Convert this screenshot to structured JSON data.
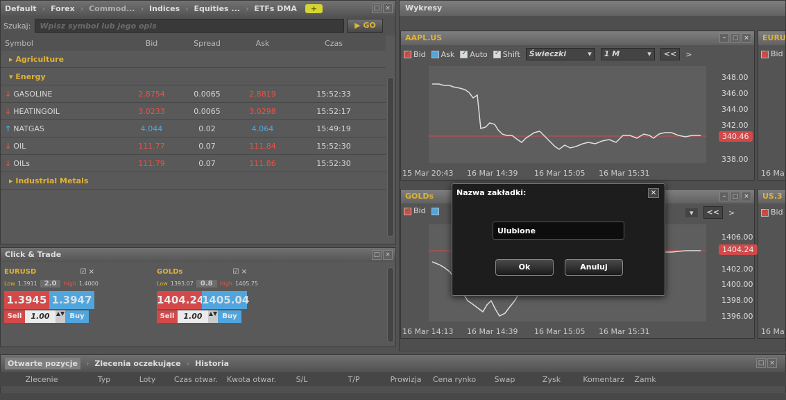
{
  "top_tabs": [
    "Default",
    "Forex",
    "Commod...",
    "Indices",
    "Equities ...",
    "ETFs DMA"
  ],
  "add_tab_label": "+",
  "search": {
    "label": "Szukaj:",
    "placeholder": "Wpisz symbol lub jego opis",
    "go": "▶ GO"
  },
  "table": {
    "headers": {
      "symbol": "Symbol",
      "bid": "Bid",
      "spread": "Spread",
      "ask": "Ask",
      "time": "Czas"
    },
    "groups": {
      "agriculture": "▸ Agriculture",
      "energy": "▾ Energy",
      "industrial": "▸ Industrial Metals"
    },
    "rows": [
      {
        "symbol": "GASOLINE",
        "bid": "2.8754",
        "spread": "0.0065",
        "ask": "2.8819",
        "time": "15:52:33",
        "dir": "down"
      },
      {
        "symbol": "HEATINGOIL",
        "bid": "3.0233",
        "spread": "0.0065",
        "ask": "3.0298",
        "time": "15:52:17",
        "dir": "down"
      },
      {
        "symbol": "NATGAS",
        "bid": "4.044",
        "spread": "0.02",
        "ask": "4.064",
        "time": "15:49:19",
        "dir": "up"
      },
      {
        "symbol": "OIL",
        "bid": "111.77",
        "spread": "0.07",
        "ask": "111.84",
        "time": "15:52:30",
        "dir": "down"
      },
      {
        "symbol": "OILs",
        "bid": "111.79",
        "spread": "0.07",
        "ask": "111.86",
        "time": "15:52:30",
        "dir": "down"
      }
    ]
  },
  "click_trade": {
    "title": "Click & Trade",
    "cards": [
      {
        "symbol": "EURUSD",
        "low_label": "Low",
        "low": "1.3911",
        "spread": "2.0",
        "high_label": "High",
        "high": "1.4000",
        "sell_price": "1.3945",
        "buy_price": "1.3947",
        "sell": "Sell",
        "buy": "Buy",
        "qty": "1.00"
      },
      {
        "symbol": "GOLDs",
        "low_label": "Low",
        "low": "1393.07",
        "spread": "0.8",
        "high_label": "High",
        "high": "1405.75",
        "sell_price": "1404.24",
        "buy_price": "1405.04",
        "sell": "Sell",
        "buy": "Buy",
        "qty": "1.00"
      }
    ]
  },
  "charts_tab": "Wykresy",
  "chart1": {
    "symbol": "AAPL.US",
    "toolbar": {
      "bid": "Bid",
      "ask": "Ask",
      "auto": "Auto",
      "shift": "Shift",
      "type": "Świeczki",
      "interval": "1 M",
      "prev": "<<",
      "next": ">"
    },
    "y_ticks": [
      "348.00",
      "346.00",
      "344.00",
      "342.00",
      "340.46",
      "338.00"
    ],
    "x_ticks": [
      "15 Mar 20:43",
      "16 Mar 14:39",
      "16 Mar 15:05",
      "16 Mar 15:31"
    ],
    "current": "340.46"
  },
  "chart2": {
    "symbol": "GOLDs",
    "toolbar": {
      "bid": "Bid",
      "prev": "<<",
      "next": ">"
    },
    "y_ticks": [
      "1406.00",
      "1404.24",
      "1402.00",
      "1400.00",
      "1398.00",
      "1396.00"
    ],
    "x_ticks": [
      "16 Mar 14:13",
      "16 Mar 14:39",
      "16 Mar 15:05",
      "16 Mar 15:31"
    ],
    "current": "1404.24"
  },
  "side_charts": {
    "top": "EURU",
    "bottom": "US.3",
    "bid": "Bid",
    "date": "16 Ma"
  },
  "dialog": {
    "title": "Nazwa zakładki:",
    "value": "Ulubione",
    "ok": "Ok",
    "cancel": "Anuluj",
    "close": "×"
  },
  "bottom": {
    "tabs": [
      "Otwarte pozycje",
      "Zlecenia oczekujące",
      "Historia"
    ],
    "headers": [
      "Zlecenie",
      "Typ",
      "Loty",
      "Czas otwar.",
      "Kwota otwar.",
      "S/L",
      "T/P",
      "Prowizja",
      "Cena rynko",
      "Swap",
      "Zysk",
      "Komentarz",
      "Zamk"
    ]
  }
}
